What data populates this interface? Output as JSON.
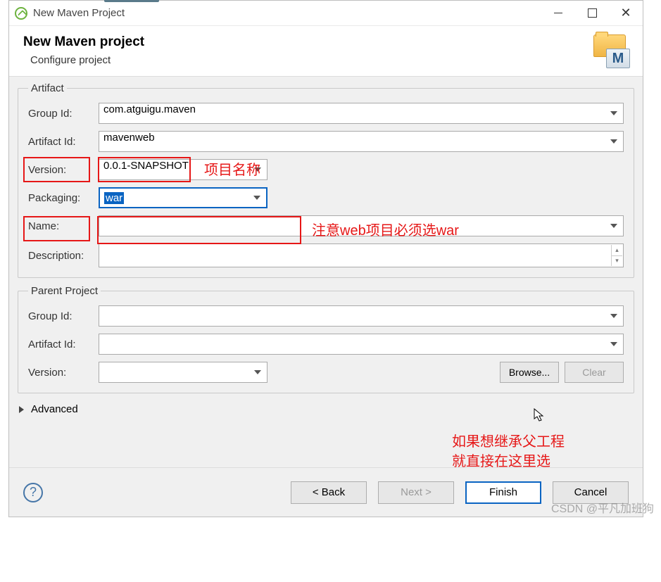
{
  "window": {
    "title": "New Maven Project"
  },
  "header": {
    "heading": "New Maven project",
    "subtitle": "Configure project",
    "badge_letter": "M"
  },
  "artifact": {
    "legend": "Artifact",
    "group_id_label": "Group Id:",
    "group_id_value": "com.atguigu.maven",
    "artifact_id_label": "Artifact Id:",
    "artifact_id_value": "mavenweb",
    "version_label": "Version:",
    "version_value": "0.0.1-SNAPSHOT",
    "packaging_label": "Packaging:",
    "packaging_value": "war",
    "name_label": "Name:",
    "name_value": "",
    "description_label": "Description:",
    "description_value": ""
  },
  "parent": {
    "legend": "Parent Project",
    "group_id_label": "Group Id:",
    "group_id_value": "",
    "artifact_id_label": "Artifact Id:",
    "artifact_id_value": "",
    "version_label": "Version:",
    "version_value": "",
    "browse_label": "Browse...",
    "clear_label": "Clear"
  },
  "advanced_label": "Advanced",
  "footer": {
    "back": "< Back",
    "next": "Next >",
    "finish": "Finish",
    "cancel": "Cancel"
  },
  "annotations": {
    "artifact_name": "项目名称",
    "packaging_note": "注意web项目必须选war",
    "parent_note_l1": "如果想继承父工程",
    "parent_note_l2": "就直接在这里选"
  },
  "watermark": "CSDN @平凡加班狗"
}
